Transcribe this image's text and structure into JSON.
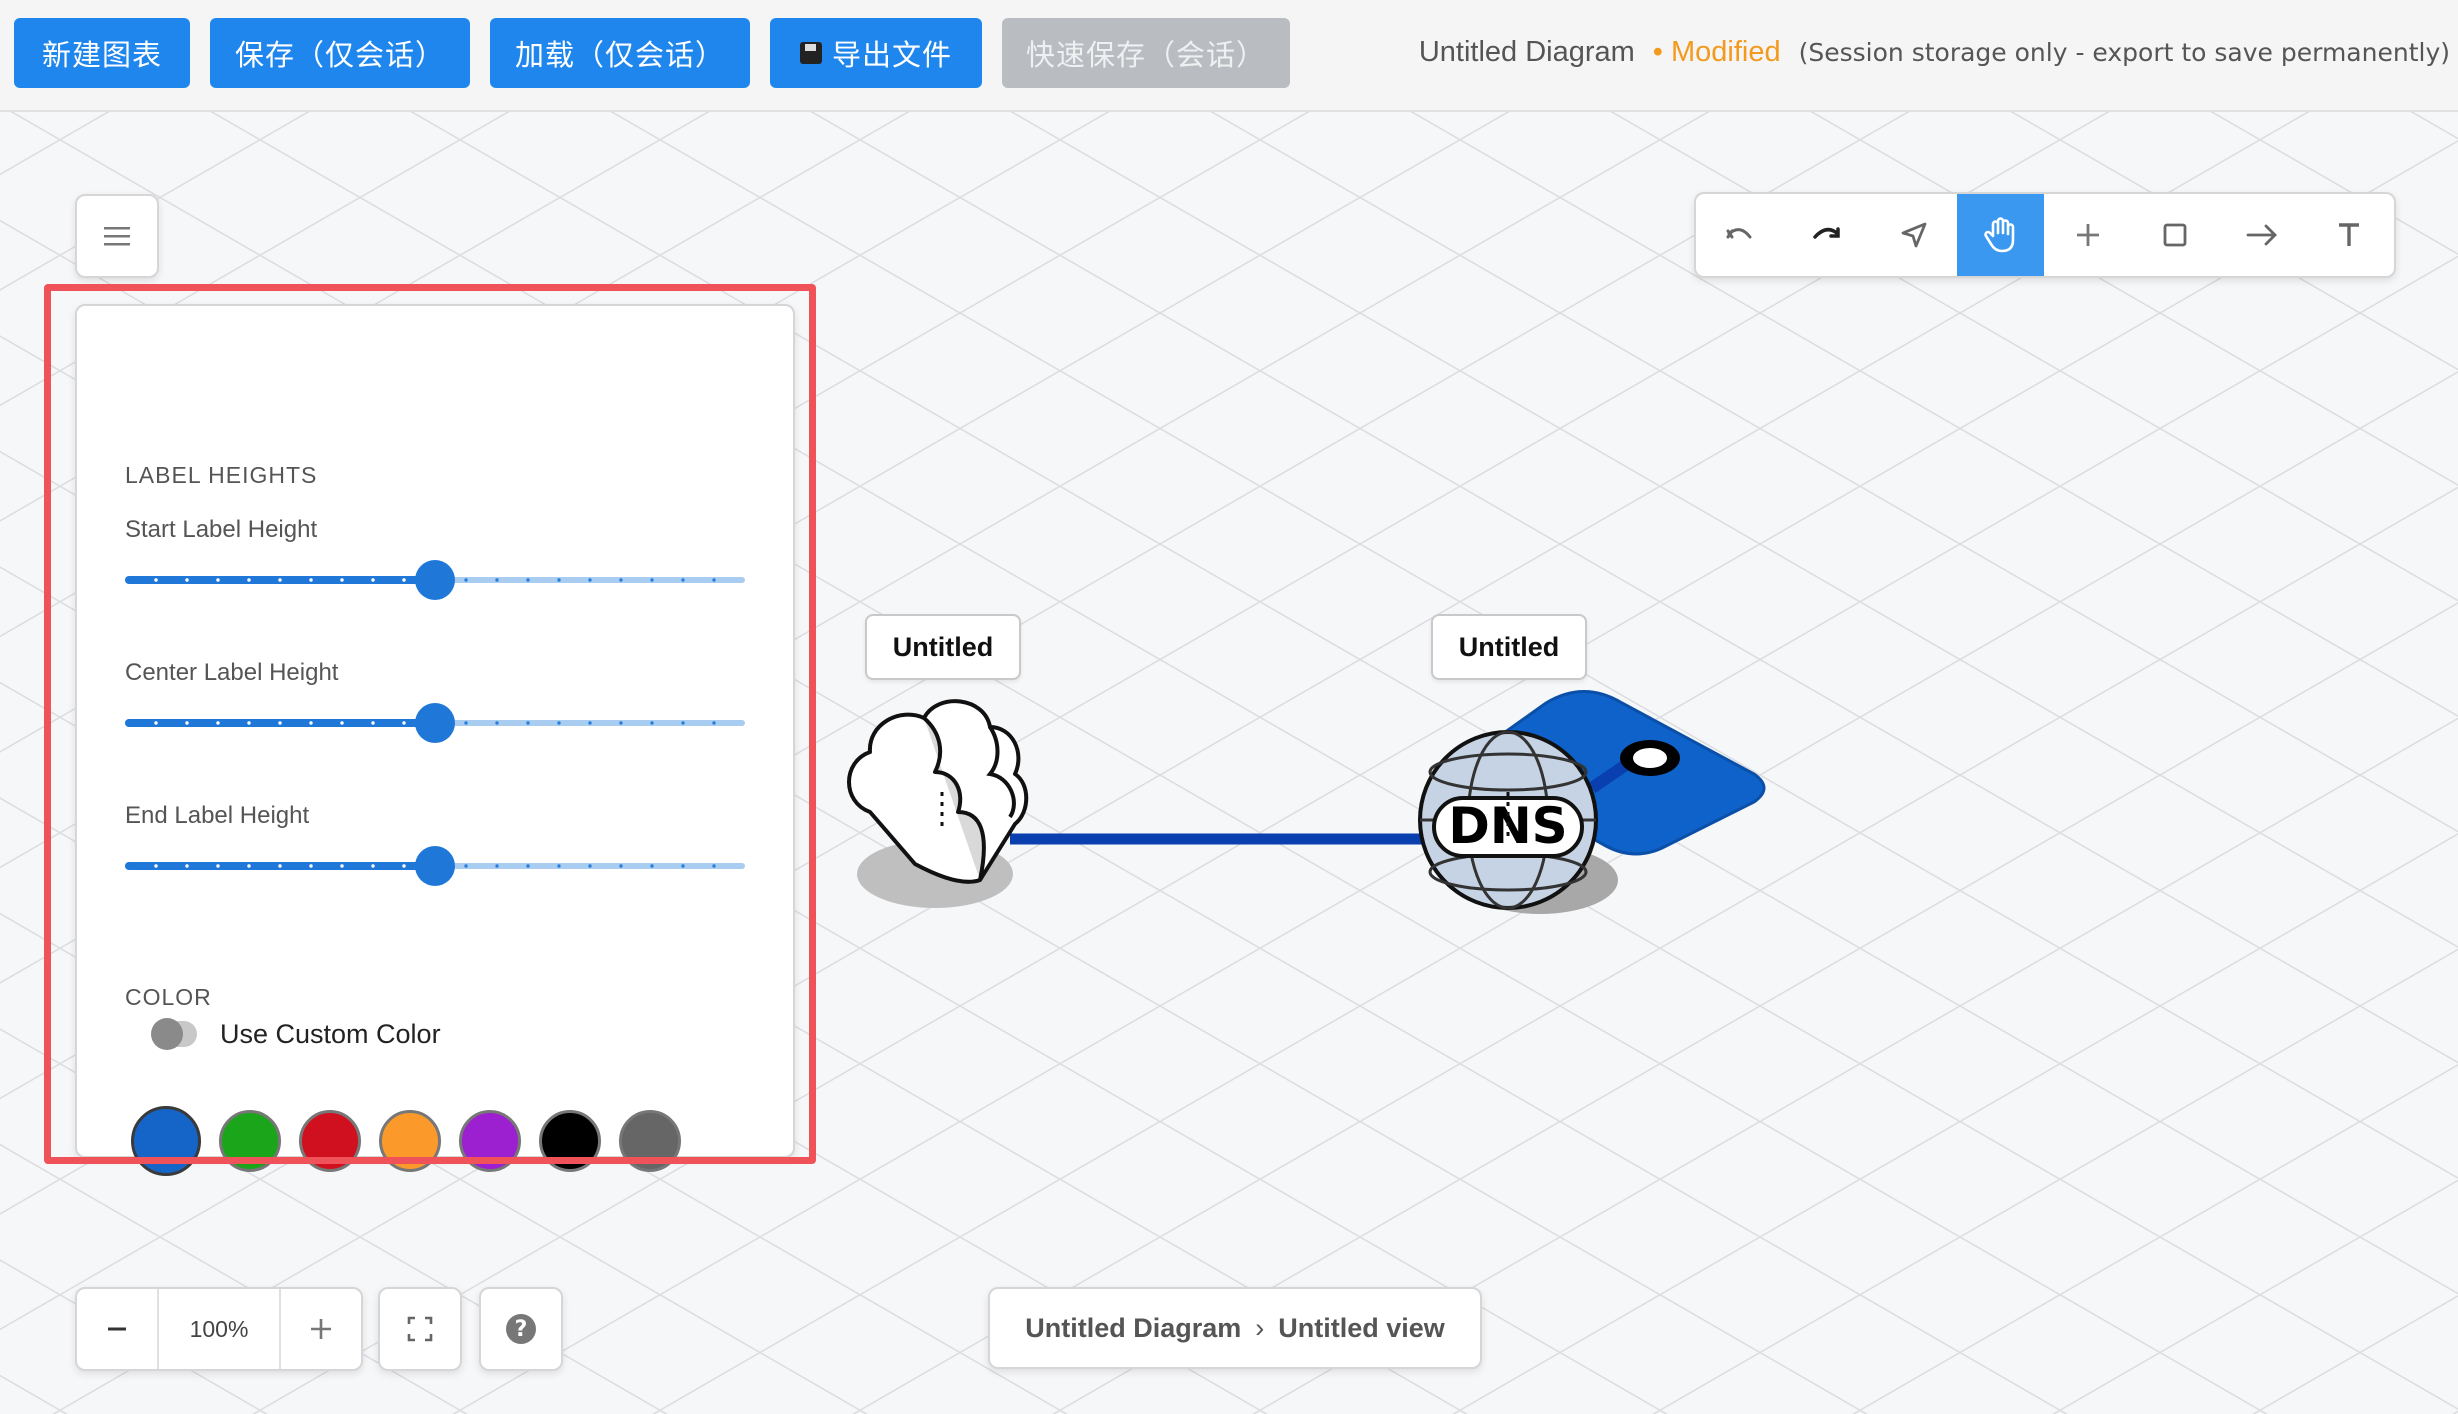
{
  "toolbar": {
    "new_diagram": "新建图表",
    "save_session": "保存（仅会话）",
    "load_session": "加载（仅会话）",
    "export_file": "导出文件",
    "quick_save": "快速保存（会话）"
  },
  "header": {
    "title": "Untitled Diagram",
    "modified": "• Modified",
    "note": "(Session storage only - export to save permanently)"
  },
  "panel": {
    "label_heights_title": "LABEL HEIGHTS",
    "sliders": [
      {
        "label": "Start Label Height",
        "value": 0.5
      },
      {
        "label": "Center Label Height",
        "value": 0.5
      },
      {
        "label": "End Label Height",
        "value": 0.5
      }
    ],
    "color_title": "COLOR",
    "custom_color_label": "Use Custom Color",
    "custom_color_enabled": false,
    "swatches": [
      "#1565c8",
      "#1aa51a",
      "#d0101e",
      "#fb9a2a",
      "#9c1fd0",
      "#000000",
      "#666666"
    ],
    "selected_swatch": "#1565c8"
  },
  "nodes": [
    {
      "label": "Untitled",
      "icon": "cloud-icon"
    },
    {
      "label": "Untitled",
      "icon": "dns-globe-icon",
      "text": "DNS"
    }
  ],
  "connector_color": "#0a3fb0",
  "zoom": {
    "value": "100%"
  },
  "breadcrumb": {
    "diagram": "Untitled Diagram",
    "separator": "›",
    "view": "Untitled view"
  },
  "tools": [
    "undo-icon",
    "redo-icon",
    "select-icon",
    "pan-icon",
    "add-icon",
    "rectangle-icon",
    "connector-icon",
    "text-icon"
  ],
  "active_tool": "pan-icon"
}
